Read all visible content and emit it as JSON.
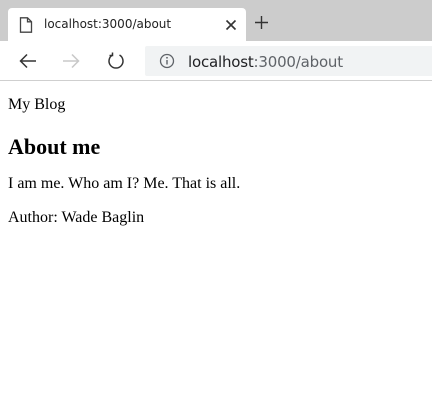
{
  "tab": {
    "title": "localhost:3000/about"
  },
  "address_bar": {
    "host": "localhost",
    "path": ":3000/about"
  },
  "page": {
    "site_link": "My Blog",
    "title": "About me",
    "body": "I am me. Who am I? Me. That is all.",
    "author": "Author: Wade Baglin"
  },
  "icons": {
    "favicon": "page-icon",
    "tab_close": "close-icon",
    "new_tab": "plus-icon",
    "back": "arrow-left-icon",
    "forward": "arrow-right-icon",
    "reload": "reload-icon",
    "site_info": "info-icon"
  }
}
